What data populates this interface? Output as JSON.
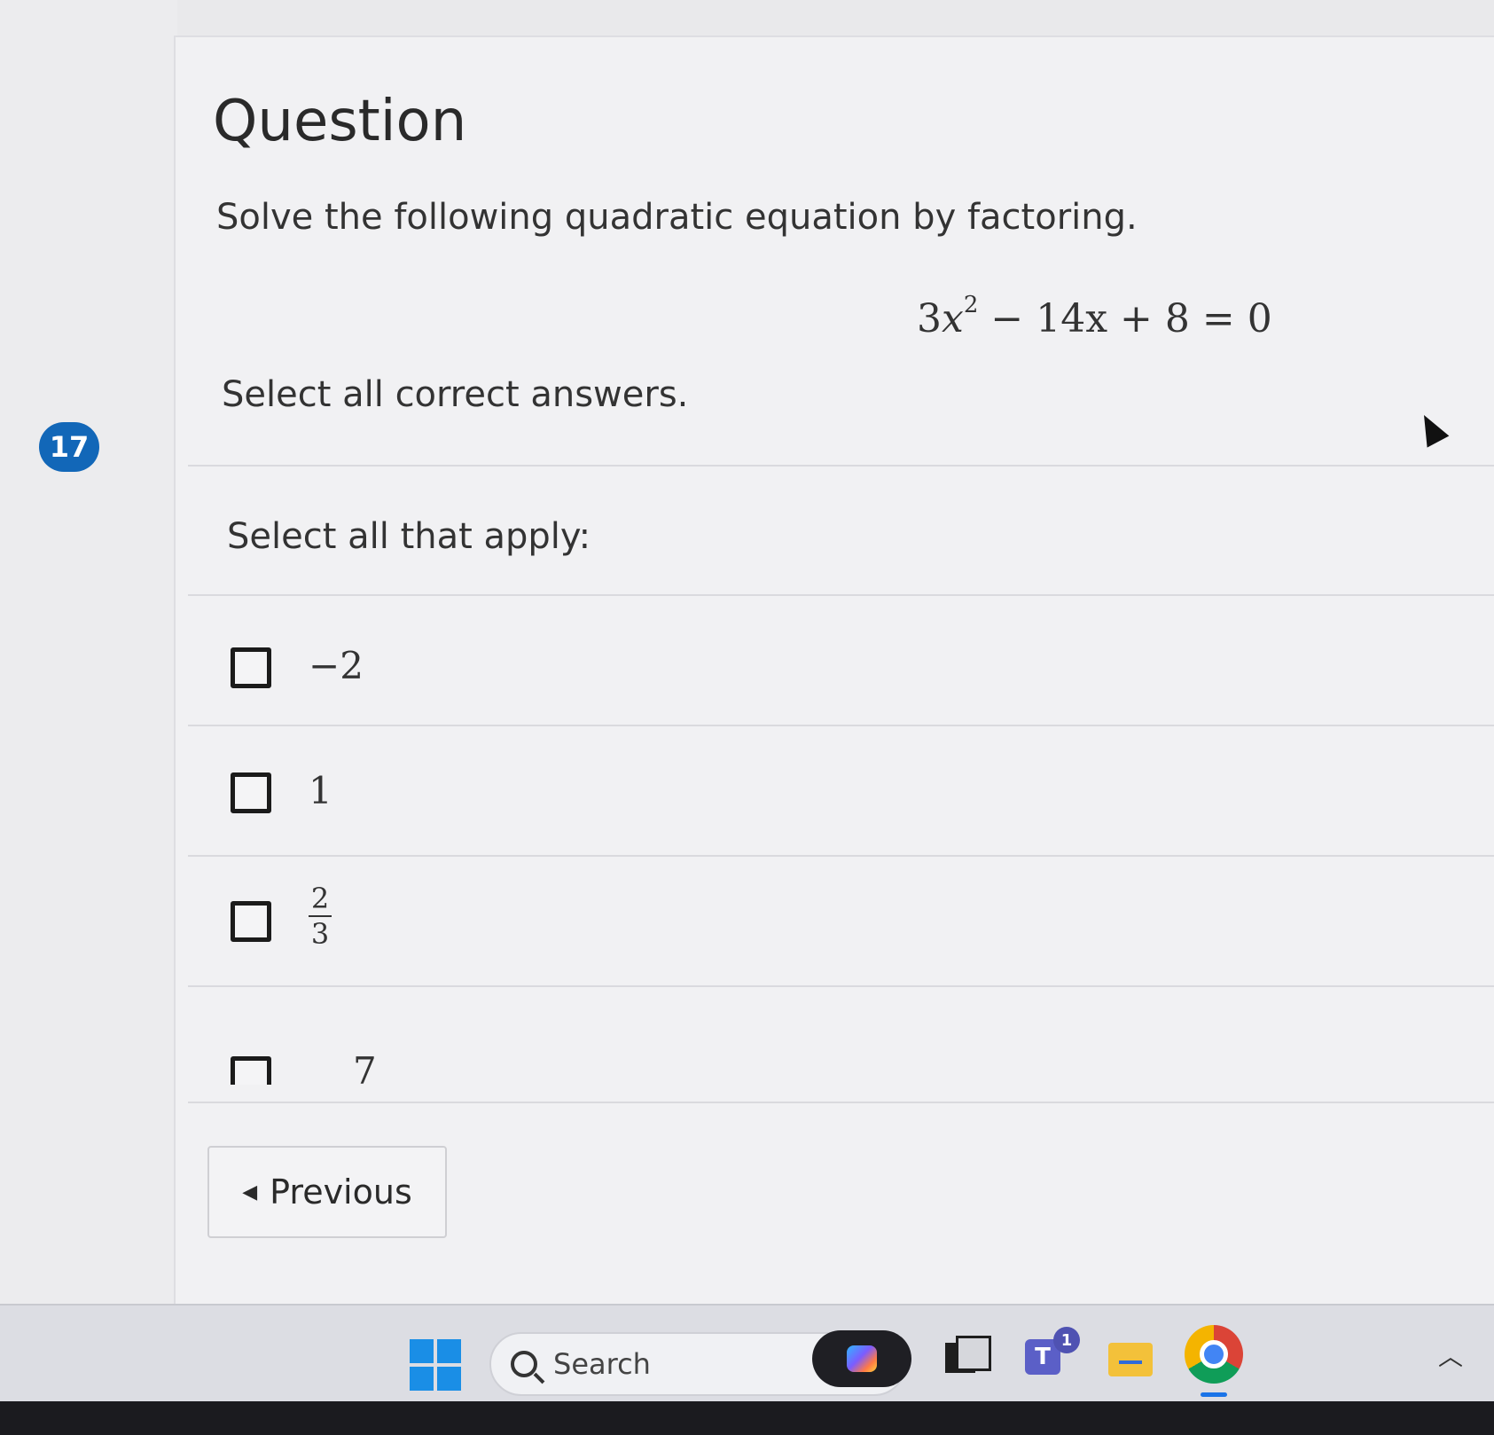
{
  "question_number": "17",
  "question": {
    "title": "Question",
    "prompt": "Solve the following quadratic equation by factoring.",
    "equation": {
      "coef": "3",
      "var": "x",
      "exponent": "2",
      "rest": " − 14x + 8 = 0"
    },
    "instruction": "Select all correct answers.",
    "apply_label": "Select all that apply:"
  },
  "options": [
    {
      "label": "−2",
      "checked": false
    },
    {
      "label": "1",
      "checked": false
    },
    {
      "numerator": "2",
      "denominator": "3",
      "checked": false
    },
    {
      "label": "7",
      "checked": false
    }
  ],
  "navigation": {
    "previous_label": "Previous"
  },
  "taskbar": {
    "search_placeholder": "Search",
    "teams_badge": "1"
  },
  "colors": {
    "accent": "#1267b8",
    "windows_blue": "#1a8ee6"
  }
}
